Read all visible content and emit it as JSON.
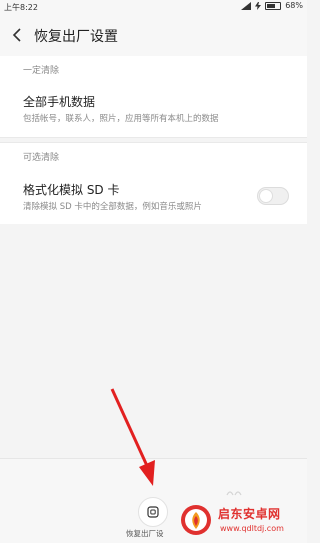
{
  "status_bar": {
    "time": "上午8:22",
    "battery_percent": "68%"
  },
  "header": {
    "title": "恢复出厂设置"
  },
  "section_required": {
    "label": "一定清除",
    "item_title": "全部手机数据",
    "item_desc": "包括帐号，联系人，照片，应用等所有本机上的数据"
  },
  "section_optional": {
    "label": "可选清除",
    "item_title": "格式化模拟 SD 卡",
    "item_desc": "清除模拟 SD 卡中的全部数据，例如音乐或照片",
    "toggle_on": false
  },
  "footer": {
    "reset_label": "恢复出厂设"
  },
  "watermark": {
    "cn": "启东安卓网",
    "en": "www.qdltdj.com"
  },
  "colors": {
    "arrow": "#e22020",
    "watermark": "#e0312f"
  },
  "icons": [
    "back-arrow-icon",
    "signal-icon",
    "battery-icon",
    "charging-icon",
    "reset-phone-icon",
    "watermark-logo-icon"
  ]
}
